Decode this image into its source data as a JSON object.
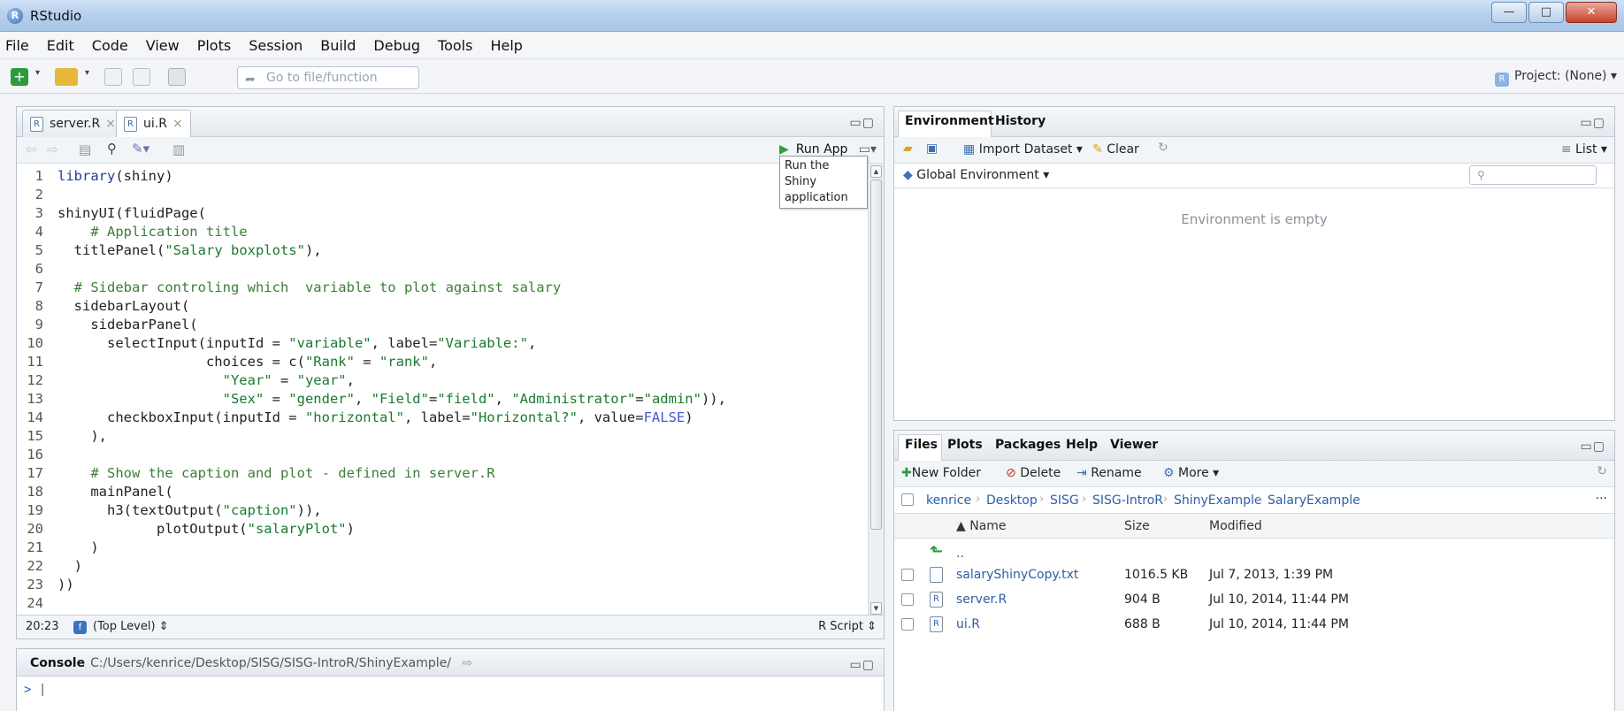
{
  "window": {
    "title": "RStudio",
    "min": "—",
    "max": "□",
    "close": "✕"
  },
  "menu": [
    "File",
    "Edit",
    "Code",
    "View",
    "Plots",
    "Session",
    "Build",
    "Debug",
    "Tools",
    "Help"
  ],
  "toolbar": {
    "goto_placeholder": "Go to file/function",
    "project": "Project: (None)"
  },
  "source": {
    "tabs": [
      {
        "label": "server.R",
        "active": false
      },
      {
        "label": "ui.R",
        "active": true
      }
    ],
    "run_app": "Run App",
    "tooltip": "Run the Shiny application",
    "status": {
      "position": "20:23",
      "scope": "(Top Level)",
      "filetype": "R Script"
    },
    "lines": [
      {
        "n": "1",
        "segments": [
          [
            "fn",
            "library"
          ],
          [
            "",
            "(shiny)"
          ]
        ]
      },
      {
        "n": "2",
        "segments": [
          [
            "",
            ""
          ]
        ]
      },
      {
        "n": "3",
        "segments": [
          [
            "",
            "shinyUI(fluidPage("
          ]
        ]
      },
      {
        "n": "4",
        "segments": [
          [
            "",
            "    "
          ],
          [
            "cmt",
            "# Application title"
          ]
        ]
      },
      {
        "n": "5",
        "segments": [
          [
            "",
            "  titlePanel("
          ],
          [
            "str",
            "\"Salary boxplots\""
          ],
          [
            "",
            "),"
          ]
        ]
      },
      {
        "n": "6",
        "segments": [
          [
            "",
            ""
          ]
        ]
      },
      {
        "n": "7",
        "segments": [
          [
            "",
            "  "
          ],
          [
            "cmt",
            "# Sidebar controling which  variable to plot against salary"
          ]
        ]
      },
      {
        "n": "8",
        "segments": [
          [
            "",
            "  sidebarLayout("
          ]
        ]
      },
      {
        "n": "9",
        "segments": [
          [
            "",
            "    sidebarPanel("
          ]
        ]
      },
      {
        "n": "10",
        "segments": [
          [
            "",
            "      selectInput(inputId = "
          ],
          [
            "str",
            "\"variable\""
          ],
          [
            "",
            ", label="
          ],
          [
            "str",
            "\"Variable:\""
          ],
          [
            "",
            ","
          ]
        ]
      },
      {
        "n": "11",
        "segments": [
          [
            "",
            "                  choices = c("
          ],
          [
            "str",
            "\"Rank\""
          ],
          [
            "",
            " = "
          ],
          [
            "str",
            "\"rank\""
          ],
          [
            "",
            ","
          ]
        ]
      },
      {
        "n": "12",
        "segments": [
          [
            "",
            "                    "
          ],
          [
            "str",
            "\"Year\""
          ],
          [
            "",
            " = "
          ],
          [
            "str",
            "\"year\""
          ],
          [
            "",
            ","
          ]
        ]
      },
      {
        "n": "13",
        "segments": [
          [
            "",
            "                    "
          ],
          [
            "str",
            "\"Sex\""
          ],
          [
            "",
            " = "
          ],
          [
            "str",
            "\"gender\""
          ],
          [
            "",
            ", "
          ],
          [
            "str",
            "\"Field\""
          ],
          [
            "",
            "="
          ],
          [
            "str",
            "\"field\""
          ],
          [
            "",
            ", "
          ],
          [
            "str",
            "\"Administrator\""
          ],
          [
            "",
            "="
          ],
          [
            "str",
            "\"admin\""
          ],
          [
            "",
            ")),"
          ]
        ]
      },
      {
        "n": "14",
        "segments": [
          [
            "",
            "      checkboxInput(inputId = "
          ],
          [
            "str",
            "\"horizontal\""
          ],
          [
            "",
            ", label="
          ],
          [
            "str",
            "\"Horizontal?\""
          ],
          [
            "",
            ", value="
          ],
          [
            "kw",
            "FALSE"
          ],
          [
            "",
            ")"
          ]
        ]
      },
      {
        "n": "15",
        "segments": [
          [
            "",
            "    ),"
          ]
        ]
      },
      {
        "n": "16",
        "segments": [
          [
            "",
            ""
          ]
        ]
      },
      {
        "n": "17",
        "segments": [
          [
            "",
            "    "
          ],
          [
            "cmt",
            "# Show the caption and plot - defined in server.R"
          ]
        ]
      },
      {
        "n": "18",
        "segments": [
          [
            "",
            "    mainPanel("
          ]
        ]
      },
      {
        "n": "19",
        "segments": [
          [
            "",
            "      h3(textOutput("
          ],
          [
            "str",
            "\"caption\""
          ],
          [
            "",
            ")),"
          ]
        ]
      },
      {
        "n": "20",
        "segments": [
          [
            "",
            "            plotOutput("
          ],
          [
            "str",
            "\"salaryPlot\""
          ],
          [
            "",
            ")"
          ]
        ]
      },
      {
        "n": "21",
        "segments": [
          [
            "",
            "    )"
          ]
        ]
      },
      {
        "n": "22",
        "segments": [
          [
            "",
            "  )"
          ]
        ]
      },
      {
        "n": "23",
        "segments": [
          [
            "",
            "))"
          ]
        ]
      },
      {
        "n": "24",
        "segments": [
          [
            "",
            ""
          ]
        ]
      }
    ]
  },
  "console": {
    "title": "Console",
    "path": "C:/Users/kenrice/Desktop/SISG/SISG-IntroR/ShinyExample/",
    "prompt": ">"
  },
  "environment": {
    "tabs": [
      "Environment",
      "History"
    ],
    "import": "Import Dataset",
    "clear": "Clear",
    "list": "List",
    "scope": "Global Environment",
    "empty": "Environment is empty"
  },
  "files": {
    "tabs": [
      "Files",
      "Plots",
      "Packages",
      "Help",
      "Viewer"
    ],
    "new_folder": "New Folder",
    "delete": "Delete",
    "rename": "Rename",
    "more": "More",
    "crumbs": [
      "kenrice",
      "Desktop",
      "SISG",
      "SISG-IntroR",
      "ShinyExample",
      "SalaryExample"
    ],
    "columns": {
      "name": "Name",
      "size": "Size",
      "modified": "Modified"
    },
    "parent": "..",
    "rows": [
      {
        "name": "salaryShinyCopy.txt",
        "size": "1016.5 KB",
        "modified": "Jul 7, 2013, 1:39 PM"
      },
      {
        "name": "server.R",
        "size": "904 B",
        "modified": "Jul 10, 2014, 11:44 PM"
      },
      {
        "name": "ui.R",
        "size": "688 B",
        "modified": "Jul 10, 2014, 11:44 PM"
      }
    ]
  }
}
